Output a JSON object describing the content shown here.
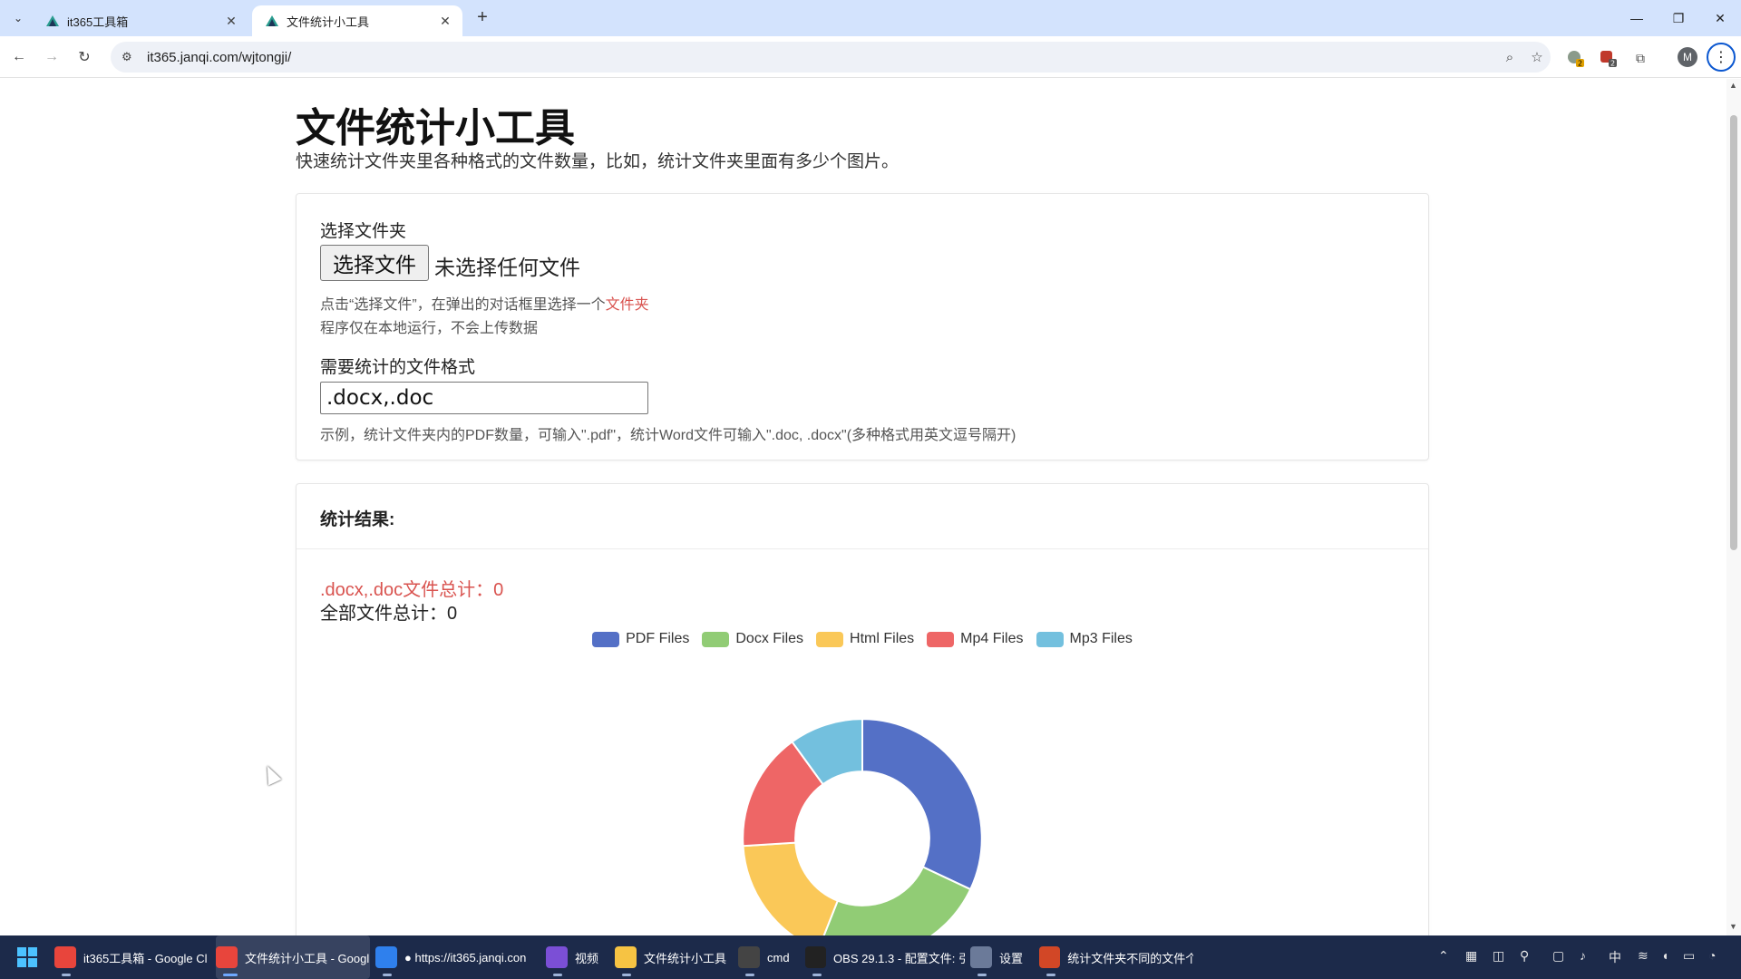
{
  "browser": {
    "tabs": [
      {
        "title": "it365工具箱",
        "active": false
      },
      {
        "title": "文件统计小工具",
        "active": true
      }
    ],
    "url": "it365.janqi.com/wjtongji/",
    "profile_initial": "M",
    "ext_badges": [
      "2",
      "2"
    ]
  },
  "page": {
    "title": "文件统计小工具",
    "subtitle": "快速统计文件夹里各种格式的文件数量，比如，统计文件夹里面有多少个图片。",
    "folder_section": {
      "label": "选择文件夹",
      "button_label": "选择文件",
      "no_file_text": "未选择任何文件",
      "hint_prefix": "点击“选择文件”，在弹出的对话框里选择一个",
      "hint_accent": "文件夹",
      "hint_local": "程序仅在本地运行，不会上传数据"
    },
    "format_section": {
      "label": "需要统计的文件格式",
      "input_value": ".docx,.doc",
      "example": "示例，统计文件夹内的PDF数量，可输入\".pdf\"，统计Word文件可输入\".doc, .docx\"(多种格式用英文逗号隔开)"
    },
    "results": {
      "header": "统计结果:",
      "format_total": ".docx,.doc文件总计：0",
      "all_total": "全部文件总计：0"
    }
  },
  "chart_data": {
    "type": "pie",
    "donut": true,
    "legend_position": "top",
    "labels": [
      "PDF Files",
      "Docx Files",
      "Html Files",
      "Mp4 Files",
      "Mp3 Files"
    ],
    "values": [
      32,
      24,
      18,
      16,
      10
    ],
    "colors": [
      "#5470c6",
      "#91cc75",
      "#fac858",
      "#ee6666",
      "#73c0de"
    ]
  },
  "taskbar": {
    "items": [
      {
        "label": "it365工具箱 - Google Cl",
        "icon": "chrome-icon",
        "color": "#e8453c"
      },
      {
        "label": "文件统计小工具 - Googl",
        "icon": "chrome-icon",
        "color": "#e8453c"
      },
      {
        "label": "● https://it365.janqi.con",
        "icon": "vscode-icon",
        "color": "#2f80ed"
      },
      {
        "label": "视频",
        "icon": "video-icon",
        "color": "#7b4fd6"
      },
      {
        "label": "文件统计小工具",
        "icon": "folder-icon",
        "color": "#f6c343"
      },
      {
        "label": "cmd",
        "icon": "terminal-icon",
        "color": "#444"
      },
      {
        "label": "OBS 29.1.3 - 配置文件: 引",
        "icon": "obs-icon",
        "color": "#222"
      },
      {
        "label": "设置",
        "icon": "gear-icon",
        "color": "#6b7a99"
      },
      {
        "label": "统计文件夹不同的文件个",
        "icon": "powerpoint-icon",
        "color": "#d24726"
      }
    ],
    "ime": "中"
  }
}
